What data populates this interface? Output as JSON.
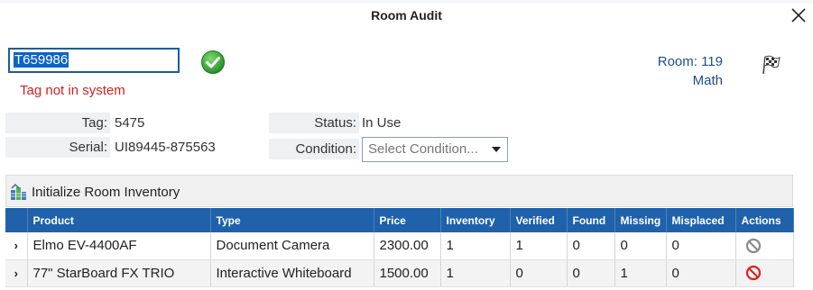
{
  "dialog": {
    "title": "Room Audit"
  },
  "tag_input": {
    "value": "T659986",
    "error": "Tag not in system"
  },
  "room": {
    "number_label": "Room: 119",
    "subject": "Math"
  },
  "details": {
    "tag_label": "Tag:",
    "tag_value": "5475",
    "serial_label": "Serial:",
    "serial_value": "UI89445-875563",
    "status_label": "Status:",
    "status_value": "In Use",
    "condition_label": "Condition:",
    "condition_placeholder": "Select Condition..."
  },
  "toolbar": {
    "init_label": "Initialize Room Inventory"
  },
  "grid": {
    "columns": [
      "Product",
      "Type",
      "Price",
      "Inventory",
      "Verified",
      "Found",
      "Missing",
      "Misplaced",
      "Actions"
    ],
    "rows": [
      {
        "product": "Elmo EV-4400AF",
        "type": "Document Camera",
        "price": "2300.00",
        "inventory": "1",
        "verified": "1",
        "found": "0",
        "missing": "0",
        "misplaced": "0",
        "action_icon": "not-allowed-icon-gray"
      },
      {
        "product": "77\" StarBoard FX TRIO",
        "type": "Interactive Whiteboard",
        "price": "1500.00",
        "inventory": "1",
        "verified": "0",
        "found": "0",
        "missing": "1",
        "misplaced": "0",
        "action_icon": "not-allowed-icon-red"
      }
    ]
  },
  "colors": {
    "header": "#1f62ab",
    "error": "#d32020",
    "link": "#1f4e8c",
    "check": "#2ea12e"
  }
}
